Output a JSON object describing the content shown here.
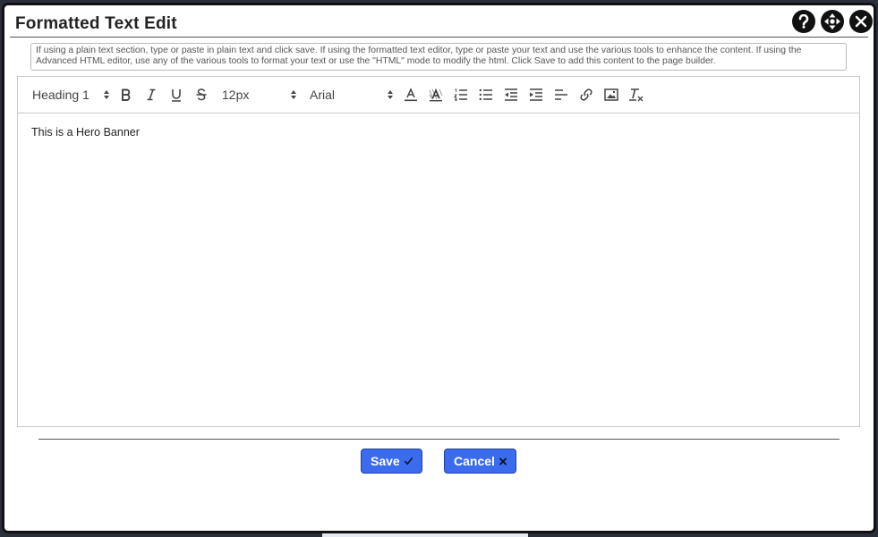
{
  "dialog": {
    "title": "Formatted Text Edit",
    "help_icon": "question-icon",
    "move_icon": "move-arrows-icon",
    "close_icon": "close-icon"
  },
  "info_text": "If using a plain text section, type or paste in plain text and click save. If using the formatted text editor, type or paste your text and use the various tools to enhance the content. If using the Advanced HTML editor, use any of the various tools to format your text or use the \"HTML\" mode to modify the html. Click Save to add this content to the page builder.",
  "toolbar": {
    "heading_value": "Heading 1",
    "size_value": "12px",
    "font_value": "Arial",
    "buttons": [
      "bold-icon",
      "italic-icon",
      "underline-icon",
      "strikethrough-icon",
      "text-color-icon",
      "highlight-icon",
      "ordered-list-icon",
      "bullet-list-icon",
      "outdent-icon",
      "indent-icon",
      "align-icon",
      "link-icon",
      "image-icon",
      "clear-format-icon"
    ]
  },
  "editor": {
    "content": "This is a Hero Banner"
  },
  "actions": {
    "save_label": "Save",
    "cancel_label": "Cancel"
  },
  "colors": {
    "button_blue": "#3b6cf0",
    "dialog_border": "#111111"
  }
}
